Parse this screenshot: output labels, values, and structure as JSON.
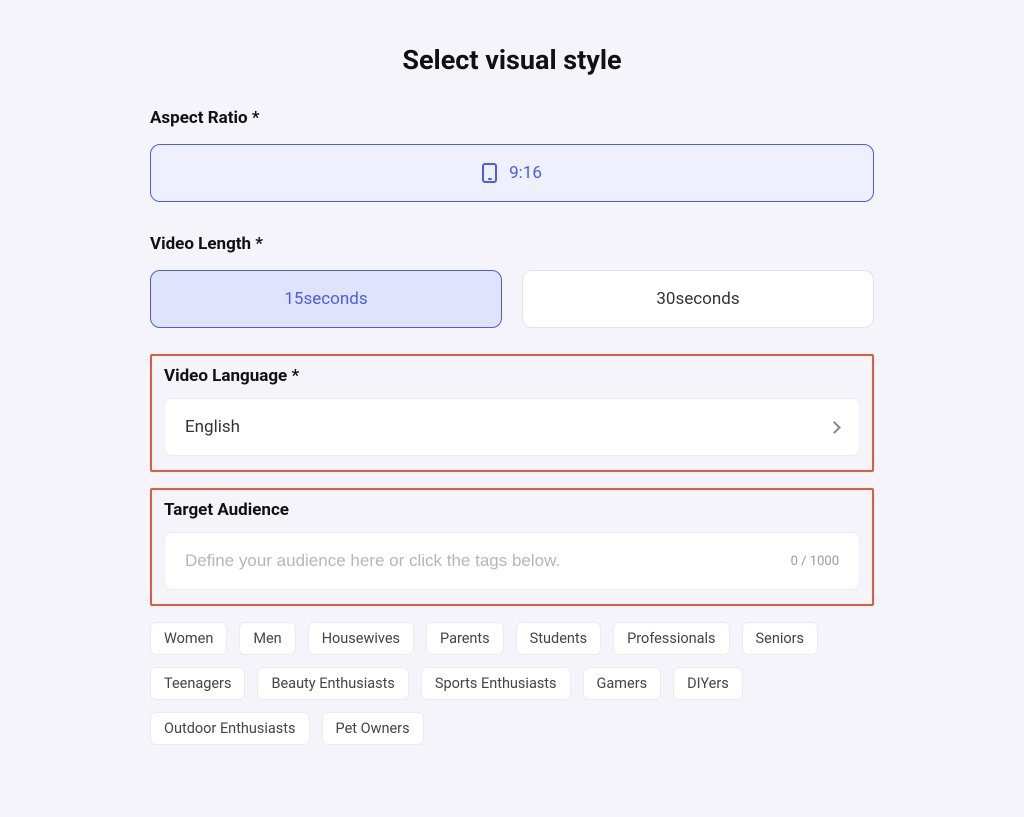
{
  "title": "Select visual style",
  "aspect": {
    "label": "Aspect Ratio *",
    "value": "9:16"
  },
  "length": {
    "label": "Video Length *",
    "options": [
      "15seconds",
      "30seconds"
    ],
    "selected": 0
  },
  "language": {
    "label": "Video Language *",
    "value": "English"
  },
  "audience": {
    "label": "Target Audience",
    "placeholder": "Define your audience here or click the tags below.",
    "value": "",
    "counter": "0 / 1000"
  },
  "tags": [
    "Women",
    "Men",
    "Housewives",
    "Parents",
    "Students",
    "Professionals",
    "Seniors",
    "Teenagers",
    "Beauty Enthusiasts",
    "Sports Enthusiasts",
    "Gamers",
    "DIYers",
    "Outdoor Enthusiasts",
    "Pet Owners"
  ]
}
